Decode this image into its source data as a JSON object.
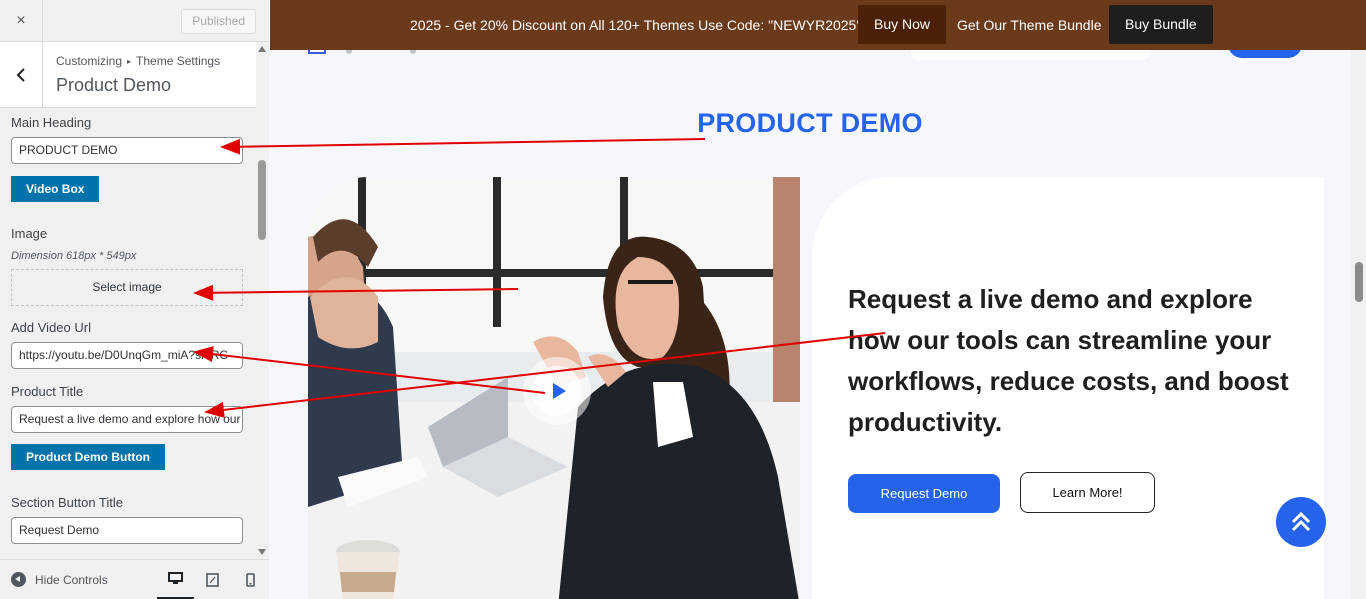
{
  "customizer": {
    "close_icon": "×",
    "published_label": "Published",
    "breadcrumb": [
      "Customizing",
      "Theme Settings"
    ],
    "breadcrumb_sep": "▸",
    "panel_title": "Product Demo",
    "fields": {
      "main_heading_label": "Main Heading",
      "main_heading_value": "PRODUCT DEMO",
      "video_box_label": "Video Box",
      "image_label": "Image",
      "dimension_note": "Dimension 618px * 549px",
      "select_image_label": "Select image",
      "video_url_label": "Add Video Url",
      "video_url_value": "https://youtu.be/D0UnqGm_miA?si=RC",
      "product_title_label": "Product Title",
      "product_title_value": "Request a live demo and explore how our tools can streamline your workflows, reduce costs, and boost productivity.",
      "product_demo_button_label": "Product Demo Button",
      "section_button_title_label": "Section Button Title",
      "section_button_title_value": "Request Demo"
    },
    "footer": {
      "hide_controls_label": "Hide Controls",
      "devices": [
        "desktop",
        "tablet",
        "mobile"
      ],
      "active_device": "desktop"
    }
  },
  "preview": {
    "promo": {
      "text": "2025 - Get 20% Discount on All 120+ Themes Use Code: \"NEWYR2025\"",
      "buy_now": "Buy Now",
      "bundle_text": "Get Our Theme Bundle",
      "buy_bundle": "Buy Bundle"
    },
    "section_heading": "PRODUCT DEMO",
    "product_title": "Request a live demo and explore how our tools can streamline your workflows, reduce costs, and boost productivity.",
    "buttons": {
      "request_demo": "Request Demo",
      "learn_more": "Learn More!"
    }
  },
  "colors": {
    "accent_blue": "#2563eb",
    "promo_bar": "#6b3a1b",
    "wp_button": "#0073aa",
    "annotation_arrow": "#e00000"
  }
}
